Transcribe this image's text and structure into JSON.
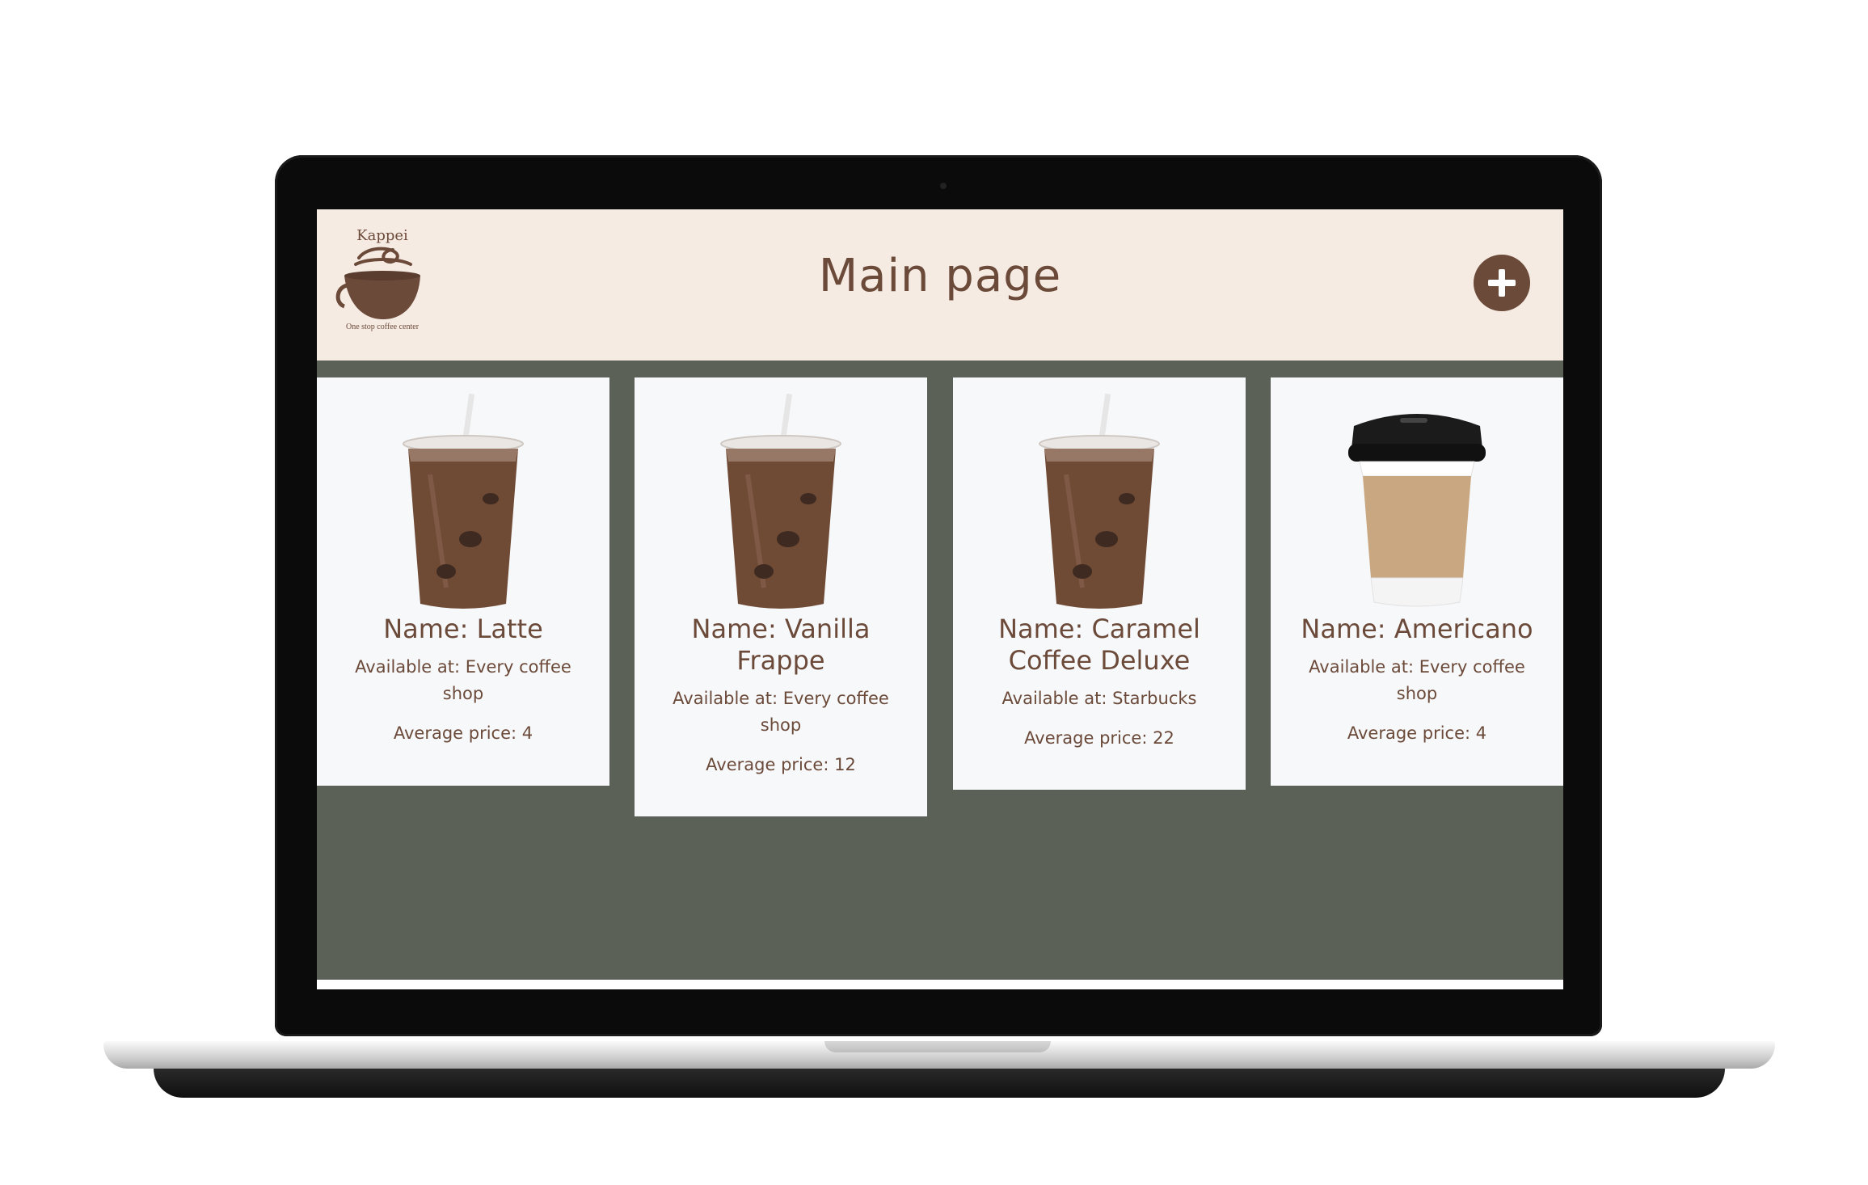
{
  "header": {
    "title": "Main page",
    "logo_word": "Kappei",
    "logo_tagline": "One stop coffee center",
    "add_icon": "plus-icon"
  },
  "products": [
    {
      "name": "Name: Latte",
      "available": "Available at: Every coffee shop",
      "price": "Average price: 4",
      "image": "iced-coffee-cup"
    },
    {
      "name": "Name: Vanilla Frappe",
      "available": "Available at: Every coffee shop",
      "price": "Average price: 12",
      "image": "iced-coffee-cup"
    },
    {
      "name": "Name: Caramel Coffee Deluxe",
      "available": "Available at: Starbucks",
      "price": "Average price: 22",
      "image": "iced-coffee-cup"
    },
    {
      "name": "Name: Americano",
      "available": "Available at: Every coffee shop",
      "price": "Average price: 4",
      "image": "hot-coffee-cup"
    }
  ],
  "colors": {
    "brand_brown": "#6b4a3a",
    "header_bg": "#f6ebe2",
    "page_bg": "#5b6156",
    "card_bg": "#f7f8fa"
  }
}
